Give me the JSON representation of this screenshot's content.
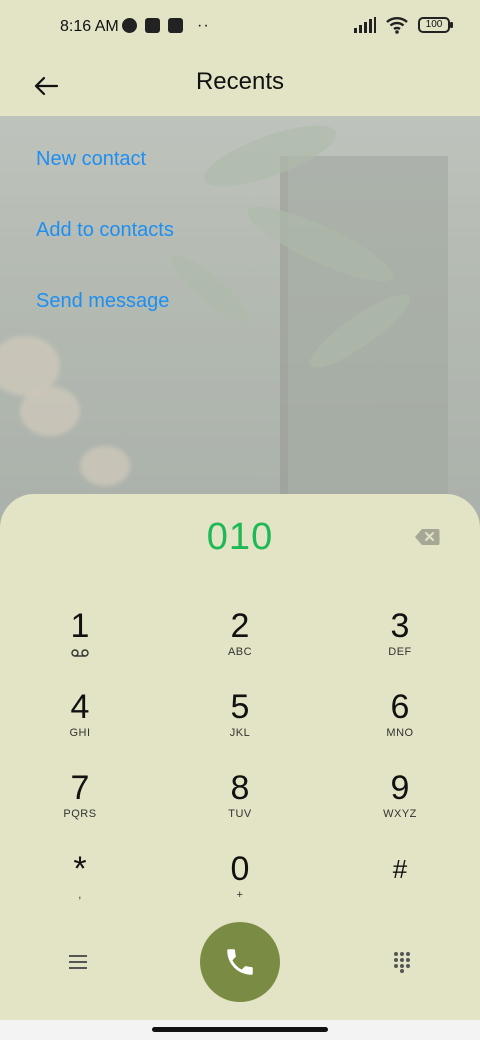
{
  "status_bar": {
    "time": "8:16 AM",
    "battery": "100"
  },
  "header": {
    "title": "Recents",
    "back_icon": "arrow-left-icon"
  },
  "actions": [
    {
      "label": "New contact"
    },
    {
      "label": "Add to contacts"
    },
    {
      "label": "Send message"
    }
  ],
  "dialer": {
    "number": "010",
    "number_color": "#1db954",
    "keys": [
      {
        "digit": "1",
        "letters": ""
      },
      {
        "digit": "2",
        "letters": "ABC"
      },
      {
        "digit": "3",
        "letters": "DEF"
      },
      {
        "digit": "4",
        "letters": "GHI"
      },
      {
        "digit": "5",
        "letters": "JKL"
      },
      {
        "digit": "6",
        "letters": "MNO"
      },
      {
        "digit": "7",
        "letters": "PQRS"
      },
      {
        "digit": "8",
        "letters": "TUV"
      },
      {
        "digit": "9",
        "letters": "WXYZ"
      },
      {
        "digit": "*",
        "letters": ","
      },
      {
        "digit": "0",
        "letters": "+"
      },
      {
        "digit": "#",
        "letters": ""
      }
    ],
    "call_button_color": "#7a8c44"
  },
  "colors": {
    "background": "#e3e3c5",
    "link": "#1f8ef1"
  }
}
